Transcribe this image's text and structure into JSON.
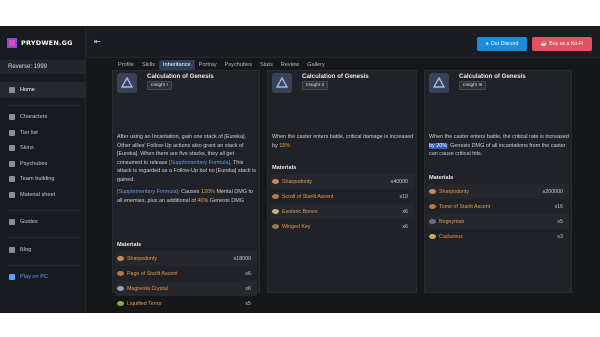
{
  "app": {
    "logo_text": "PRYDWEN.GG",
    "reverse_label": "Reverse: 1999"
  },
  "sidebar": {
    "items": [
      {
        "label": "Home",
        "icon": "home-icon"
      },
      {
        "label": "Characters",
        "icon": "characters-icon"
      },
      {
        "label": "Tier list",
        "icon": "tier-list-icon"
      },
      {
        "label": "Skins",
        "icon": "skins-icon"
      },
      {
        "label": "Psychubes",
        "icon": "psychube-icon"
      },
      {
        "label": "Team building",
        "icon": "team-icon"
      },
      {
        "label": "Material sheet",
        "icon": "material-icon"
      }
    ],
    "guides_label": "Guides",
    "blog_label": "Blog",
    "play_label": "Play on PC"
  },
  "topbar": {
    "discord_label": "Our Discord",
    "kofi_label": "Buy us a Ko-Fi"
  },
  "tabs": [
    {
      "label": "Profile",
      "active": false
    },
    {
      "label": "Skills",
      "active": false
    },
    {
      "label": "Inheritance",
      "active": true
    },
    {
      "label": "Portray",
      "active": false
    },
    {
      "label": "Psychubes",
      "active": false
    },
    {
      "label": "Stats",
      "active": false
    },
    {
      "label": "Review",
      "active": false
    },
    {
      "label": "Gallery",
      "active": false
    }
  ],
  "columns": [
    {
      "title": "Calculation of Genesis",
      "insight": "Insight I",
      "description": {
        "p1_a": "After using an Incantation, gain one stack of [Eureka]. Other allies' Follow-Up actions also grant an stack of [Eureka]. When there are five stacks, they all get consumed to release ",
        "p1_link": "[Supplementary Formula]",
        "p1_b": ". This attack is regarded as a Follow-Up but no [Eureka] stack is gained.",
        "p2_link": "[Supplementary Formula]",
        "p2_a": ": Causes ",
        "p2_pct1": "120%",
        "p2_b": " Mental DMG to all enemies, plus an additional of ",
        "p2_pct2": "40%",
        "p2_c": " Genesis DMG"
      },
      "materials_title": "Materials",
      "materials": [
        {
          "name": "Sharpodonty",
          "qty": "x18000",
          "color": "#c98a55"
        },
        {
          "name": "Page of Starlit Ascent",
          "qty": "x6",
          "color": "#b57a3c"
        },
        {
          "name": "Magnesia Crystal",
          "qty": "x6",
          "color": "#9aa0b0"
        },
        {
          "name": "Liquified Terror",
          "qty": "x5",
          "color": "#7fb04a"
        }
      ]
    },
    {
      "title": "Calculation of Genesis",
      "insight": "Insight II",
      "description": {
        "a": "When the caster enters battle, critical damage is increased by ",
        "pct": "15%"
      },
      "materials_title": "Materials",
      "materials": [
        {
          "name": "Sharpodonty",
          "qty": "x40000",
          "color": "#c98a55"
        },
        {
          "name": "Scroll of Starlit Ascent",
          "qty": "x10",
          "color": "#b57a3c"
        },
        {
          "name": "Esoteric Bones",
          "qty": "x6",
          "color": "#c9b07a"
        },
        {
          "name": "Winged Key",
          "qty": "x6",
          "color": "#8a7a5a"
        }
      ]
    },
    {
      "title": "Calculation of Genesis",
      "insight": "Insight III",
      "description": {
        "a": "When the caster enters battle, the critical rate is increased ",
        "sel": "by 20%",
        "b": "; Genesis DMG of all incantations from the caster can cause critical hits."
      },
      "materials_title": "Materials",
      "materials": [
        {
          "name": "Sharpodonty",
          "qty": "x200000",
          "color": "#c98a55"
        },
        {
          "name": "Tome of Starlit Ascent",
          "qty": "x16",
          "color": "#b57a3c"
        },
        {
          "name": "Bogeyman",
          "qty": "x5",
          "color": "#6a6f80"
        },
        {
          "name": "Caduceus",
          "qty": "x3",
          "color": "#d4a84a"
        }
      ]
    }
  ]
}
